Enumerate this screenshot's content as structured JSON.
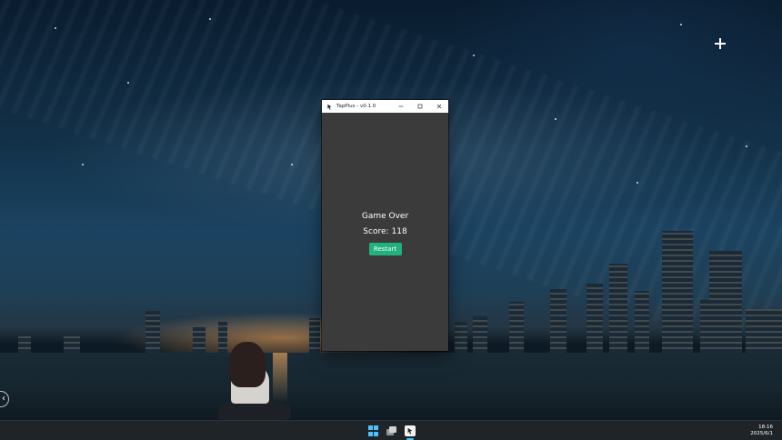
{
  "window": {
    "title": "TapPlus - v0.1.0",
    "controls": {
      "minimize_icon": "minimize-icon",
      "maximize_icon": "maximize-icon",
      "close_icon": "close-icon"
    }
  },
  "game": {
    "status_text": "Game Over",
    "score_label": "Score:",
    "score_value": "118",
    "restart_label": "Restart",
    "restart_color": "#22b07d",
    "background_color": "#3b3b3b"
  },
  "taskbar": {
    "time": "18:16",
    "date": "2025/6/1",
    "start_icon": "windows-start-icon",
    "task_view_icon": "task-view-icon",
    "app_icon": "tapplus-app-icon",
    "accent": "#4cc2ff"
  }
}
